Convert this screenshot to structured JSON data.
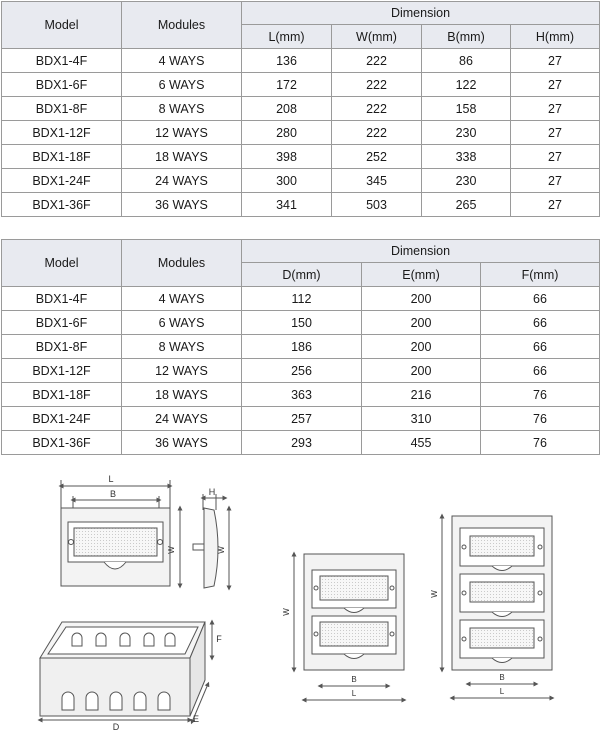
{
  "table1": {
    "headers": {
      "model": "Model",
      "modules": "Modules",
      "dimension": "Dimension"
    },
    "subheaders": [
      "L(mm)",
      "W(mm)",
      "B(mm)",
      "H(mm)"
    ],
    "rows": [
      [
        "BDX1-4F",
        "4 WAYS",
        "136",
        "222",
        "86",
        "27"
      ],
      [
        "BDX1-6F",
        "6 WAYS",
        "172",
        "222",
        "122",
        "27"
      ],
      [
        "BDX1-8F",
        "8 WAYS",
        "208",
        "222",
        "158",
        "27"
      ],
      [
        "BDX1-12F",
        "12 WAYS",
        "280",
        "222",
        "230",
        "27"
      ],
      [
        "BDX1-18F",
        "18 WAYS",
        "398",
        "252",
        "338",
        "27"
      ],
      [
        "BDX1-24F",
        "24 WAYS",
        "300",
        "345",
        "230",
        "27"
      ],
      [
        "BDX1-36F",
        "36 WAYS",
        "341",
        "503",
        "265",
        "27"
      ]
    ]
  },
  "table2": {
    "headers": {
      "model": "Model",
      "modules": "Modules",
      "dimension": "Dimension"
    },
    "subheaders": [
      "D(mm)",
      "E(mm)",
      "F(mm)"
    ],
    "rows": [
      [
        "BDX1-4F",
        "4 WAYS",
        "112",
        "200",
        "66"
      ],
      [
        "BDX1-6F",
        "6 WAYS",
        "150",
        "200",
        "66"
      ],
      [
        "BDX1-8F",
        "8 WAYS",
        "186",
        "200",
        "66"
      ],
      [
        "BDX1-12F",
        "12 WAYS",
        "256",
        "200",
        "66"
      ],
      [
        "BDX1-18F",
        "18 WAYS",
        "363",
        "216",
        "76"
      ],
      [
        "BDX1-24F",
        "24 WAYS",
        "257",
        "310",
        "76"
      ],
      [
        "BDX1-36F",
        "36 WAYS",
        "293",
        "455",
        "76"
      ]
    ]
  },
  "drawing_labels": {
    "l": "L",
    "b": "B",
    "h": "H",
    "w": "W",
    "d": "D",
    "e": "E",
    "f": "F"
  },
  "colors": {
    "header_bg": "#e8eaf0",
    "border": "#9a9a9a"
  }
}
